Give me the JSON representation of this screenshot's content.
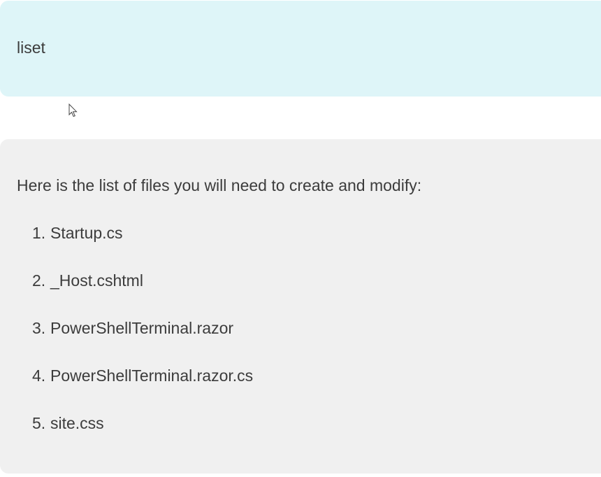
{
  "user_message": {
    "text": "liset"
  },
  "assistant_message": {
    "intro": "Here is the list of files you will need to create and modify:",
    "files": [
      {
        "number": "1.",
        "name": "Startup.cs"
      },
      {
        "number": "2.",
        "name": "_Host.cshtml"
      },
      {
        "number": "3.",
        "name": "PowerShellTerminal.razor"
      },
      {
        "number": "4.",
        "name": "PowerShellTerminal.razor.cs"
      },
      {
        "number": "5.",
        "name": "site.css"
      }
    ]
  },
  "cursor": {
    "icon": "mouse-pointer-icon"
  },
  "colors": {
    "user_bubble": "#def5f8",
    "assistant_bubble": "#f0f0f0",
    "text": "#3c3c3c"
  }
}
